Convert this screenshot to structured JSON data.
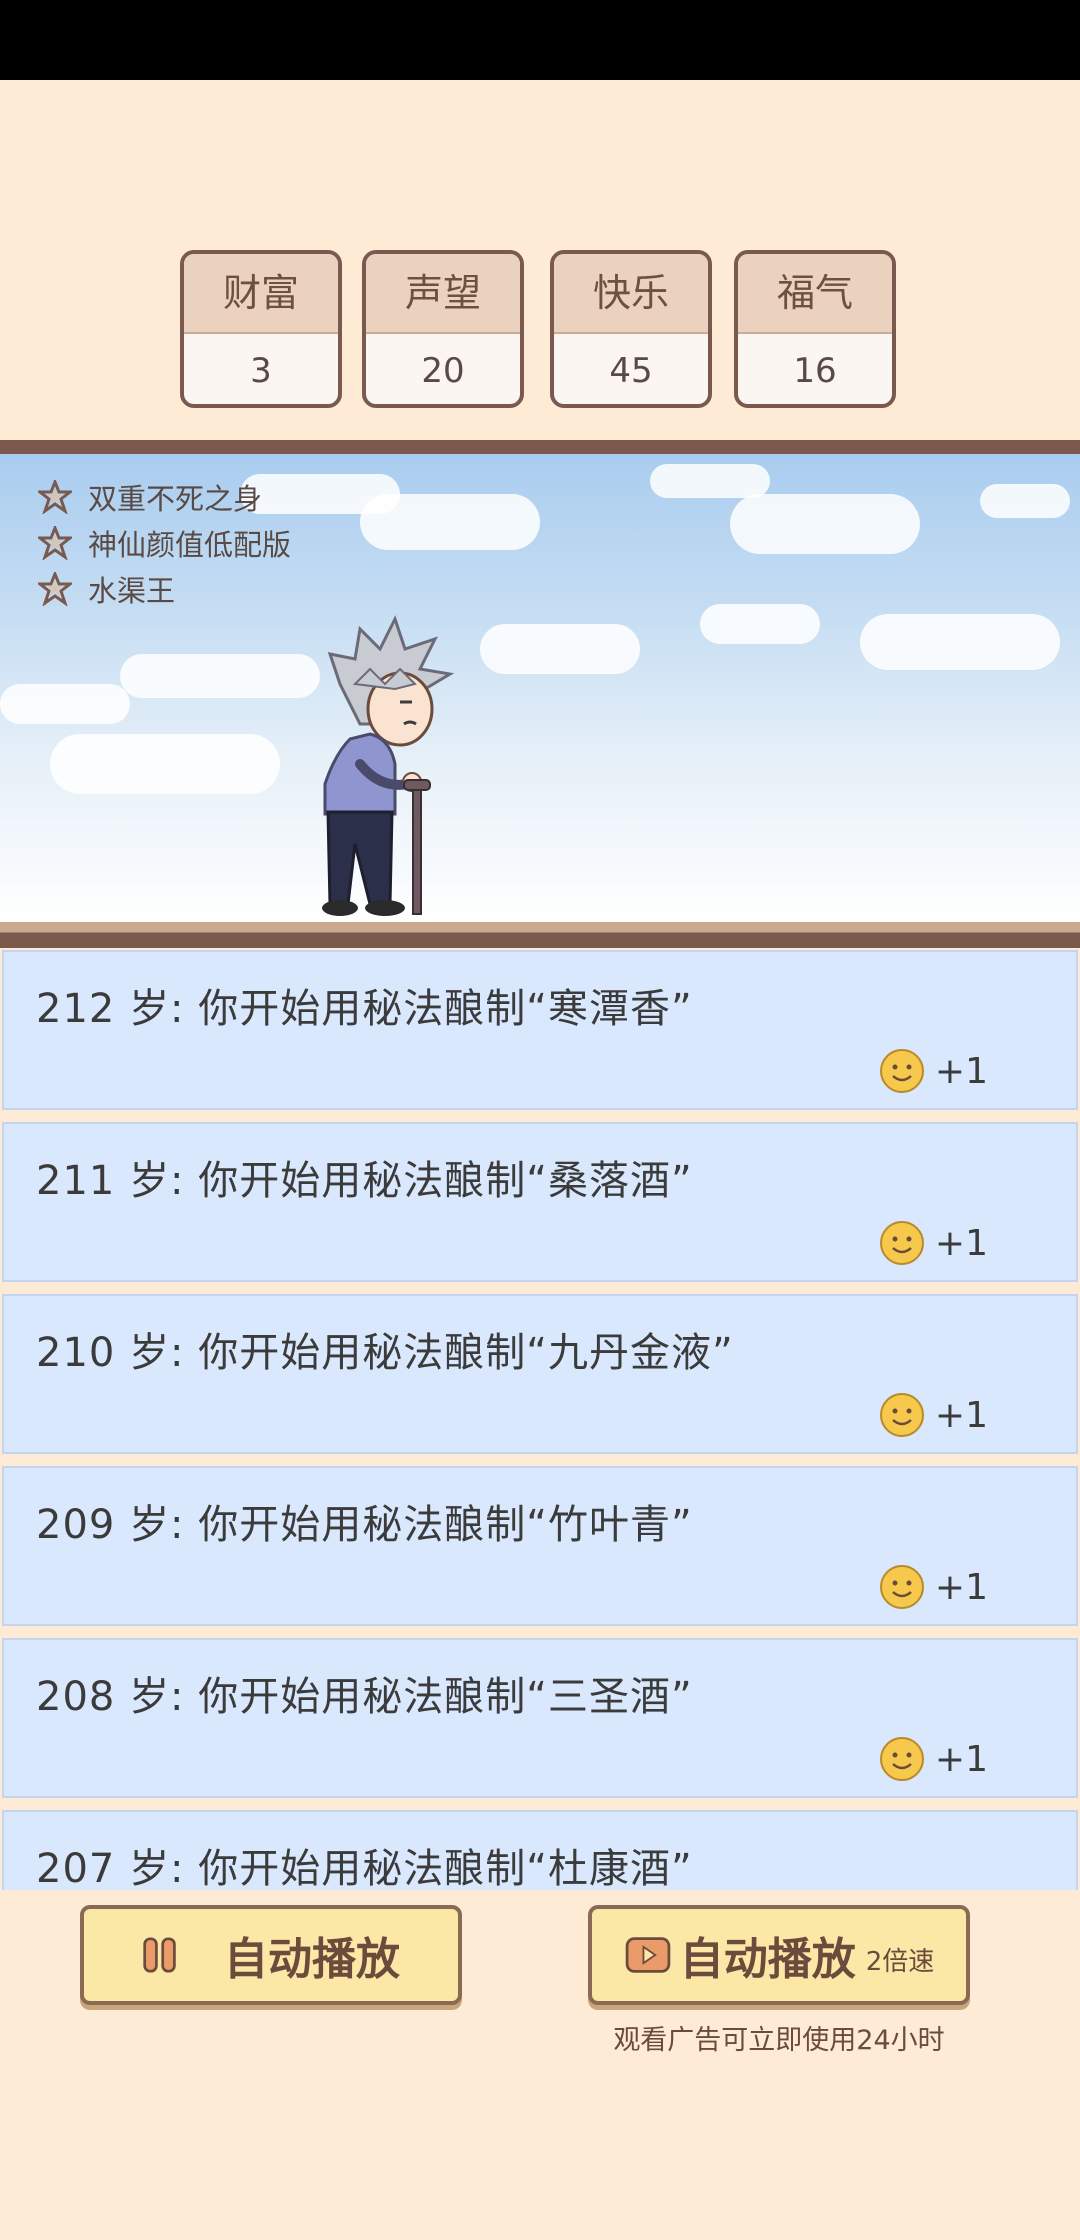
{
  "stats": [
    {
      "label": "财富",
      "value": "3"
    },
    {
      "label": "声望",
      "value": "20"
    },
    {
      "label": "快乐",
      "value": "45"
    },
    {
      "label": "福气",
      "value": "16"
    }
  ],
  "traits": [
    "双重不死之身",
    "神仙颜值低配版",
    "水渠王"
  ],
  "events": [
    {
      "text": "212  岁: 你开始用秘法酿制“寒潭香”",
      "reward": "+1"
    },
    {
      "text": "211  岁: 你开始用秘法酿制“桑落酒”",
      "reward": "+1"
    },
    {
      "text": "210  岁: 你开始用秘法酿制“九丹金液”",
      "reward": "+1"
    },
    {
      "text": "209  岁: 你开始用秘法酿制“竹叶青”",
      "reward": "+1"
    },
    {
      "text": "208  岁: 你开始用秘法酿制“三圣酒”",
      "reward": "+1"
    },
    {
      "text": "207  岁: 你开始用秘法酿制“杜康酒”",
      "reward": ""
    }
  ],
  "buttons": {
    "autoplay_label": "自动播放",
    "autoplay2x_label": "自动播放",
    "speed_label": "2倍速",
    "ad_hint": "观看广告可立即使用24小时"
  },
  "colors": {
    "background": "#fdebd6",
    "event_bg": "#d9e8fc",
    "button_bg": "#fbe7a6",
    "border_brown": "#7a5a4e"
  }
}
